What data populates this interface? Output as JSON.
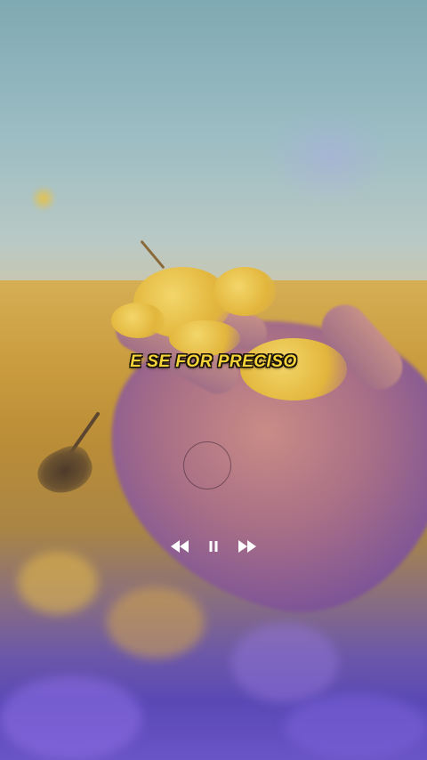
{
  "lyric": {
    "text": "E SE FOR PRECISO"
  },
  "player": {
    "controls": [
      {
        "icon": "rewind-icon"
      },
      {
        "icon": "pause-icon"
      },
      {
        "icon": "fast-forward-icon"
      }
    ]
  },
  "colors": {
    "lyric_fill": "#f4d43a",
    "lyric_outline": "#1a1206",
    "control_color": "#ffffff"
  }
}
